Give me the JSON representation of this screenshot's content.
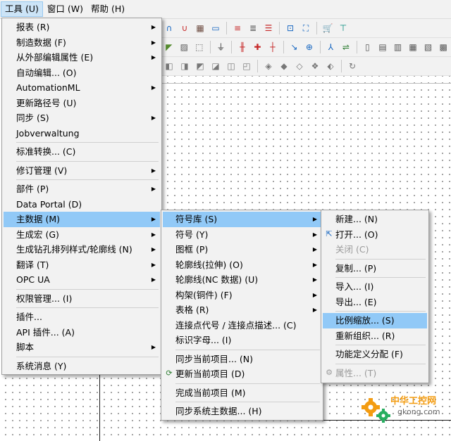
{
  "menubar": [
    {
      "label": "工具 (U)",
      "active": true
    },
    {
      "label": "窗口 (W)"
    },
    {
      "label": "帮助 (H)"
    }
  ],
  "tools_menu": [
    {
      "label": "报表 (R)",
      "sub": true
    },
    {
      "label": "制造数据 (F)",
      "sub": true
    },
    {
      "label": "从外部编辑属性 (E)",
      "sub": true
    },
    {
      "label": "自动编辑... (O)"
    },
    {
      "label": "AutomationML",
      "sub": true
    },
    {
      "label": "更新路径号 (U)"
    },
    {
      "label": "同步 (S)",
      "sub": true
    },
    {
      "label": "Jobverwaltung"
    },
    {
      "sep": true
    },
    {
      "label": "标准转换... (C)"
    },
    {
      "sep": true
    },
    {
      "label": "修订管理 (V)",
      "sub": true
    },
    {
      "sep": true
    },
    {
      "label": "部件 (P)",
      "sub": true
    },
    {
      "label": "Data Portal (D)"
    },
    {
      "label": "主数据 (M)",
      "sub": true,
      "hl": true
    },
    {
      "label": "生成宏 (G)",
      "sub": true
    },
    {
      "label": "生成钻孔排列样式/轮廓线 (N)",
      "sub": true
    },
    {
      "label": "翻译 (T)",
      "sub": true
    },
    {
      "label": "OPC UA",
      "sub": true
    },
    {
      "sep": true
    },
    {
      "label": "权限管理... (I)"
    },
    {
      "sep": true
    },
    {
      "label": "插件..."
    },
    {
      "label": "API 插件... (A)"
    },
    {
      "label": "脚本",
      "sub": true
    },
    {
      "sep": true
    },
    {
      "label": "系统消息 (Y)"
    }
  ],
  "master_data_menu": [
    {
      "label": "符号库 (S)",
      "sub": true,
      "hl": true
    },
    {
      "label": "符号 (Y)",
      "sub": true
    },
    {
      "label": "图框 (P)",
      "sub": true
    },
    {
      "label": "轮廓线(拉伸) (O)",
      "sub": true
    },
    {
      "label": "轮廓线(NC 数据) (U)",
      "sub": true
    },
    {
      "label": "构架(铜件) (F)",
      "sub": true
    },
    {
      "label": "表格 (R)",
      "sub": true
    },
    {
      "label": "连接点代号 / 连接点描述... (C)"
    },
    {
      "label": "标识字母... (I)"
    },
    {
      "sep": true
    },
    {
      "label": "同步当前项目... (N)"
    },
    {
      "label": "更新当前项目 (D)",
      "icon": "update-project-icon"
    },
    {
      "sep": true
    },
    {
      "label": "完成当前项目 (M)"
    },
    {
      "sep": true
    },
    {
      "label": "同步系统主数据... (H)"
    }
  ],
  "symbol_lib_menu": [
    {
      "label": "新建... (N)"
    },
    {
      "label": "打开... (O)",
      "icon": "open-icon"
    },
    {
      "label": "关闭 (C)",
      "disabled": true
    },
    {
      "sep": true
    },
    {
      "label": "复制... (P)"
    },
    {
      "sep": true
    },
    {
      "label": "导入... (I)"
    },
    {
      "label": "导出... (E)"
    },
    {
      "sep": true
    },
    {
      "label": "比例缩放... (S)",
      "hl": true
    },
    {
      "label": "重新组织... (R)"
    },
    {
      "sep": true
    },
    {
      "label": "功能定义分配 (F)"
    },
    {
      "sep": true
    },
    {
      "label": "属性... (T)",
      "disabled": true,
      "icon": "properties-icon"
    }
  ],
  "watermark": {
    "text_cn": "中华工控网",
    "text_en": "gkong.com"
  },
  "colors": {
    "menu_bg": "#f2f2f2",
    "highlight": "#91c9f7",
    "accent_orange": "#f39c12",
    "accent_green": "#27ae60"
  }
}
